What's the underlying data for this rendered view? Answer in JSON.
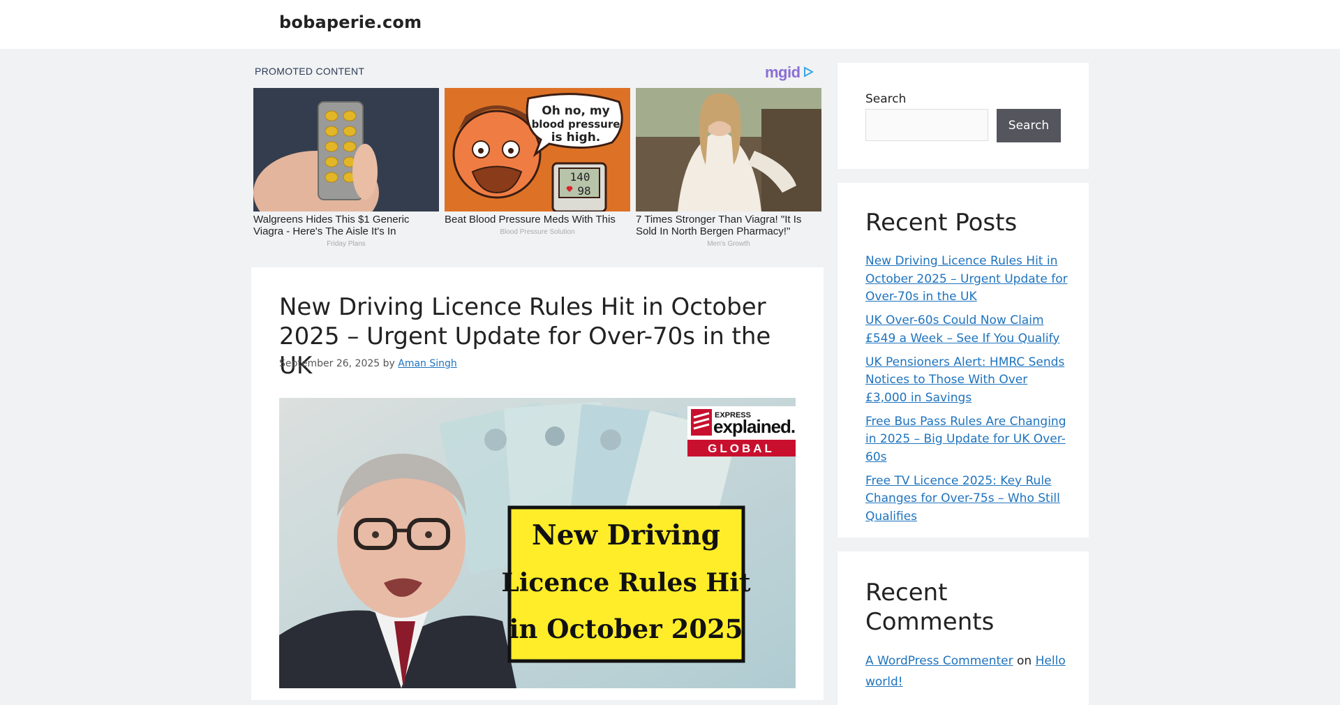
{
  "header": {
    "site_title": "bobaperie.com"
  },
  "promo": {
    "label": "PROMOTED CONTENT",
    "logo": "mgid",
    "cards": [
      {
        "title": "Walgreens Hides This $1 Generic Viagra - Here's The Aisle It's In",
        "source": "Friday Plans"
      },
      {
        "title": "Beat Blood Pressure Meds With This",
        "source": "Blood Pressure Solution",
        "bubble_line1": "Oh no, my",
        "bubble_line2": "blood pressure",
        "bubble_line3": "is high.",
        "monitor_top": "140",
        "monitor_bottom": "98"
      },
      {
        "title": "7 Times Stronger Than Viagra! \"It Is Sold In North Bergen Pharmacy!\"",
        "source": "Men's Growth"
      }
    ]
  },
  "article": {
    "title": "New Driving Licence Rules Hit in October 2025 – Urgent Update for Over-70s in the UK",
    "date": "September 26, 2025",
    "by": "by",
    "author": "Aman Singh",
    "image": {
      "badge_top": "EXPRESS",
      "badge_main": "explained.",
      "badge_sub": "GLOBAL",
      "headline_line1": "New Driving",
      "headline_line2": "Licence Rules Hit",
      "headline_line3": "in October 2025"
    }
  },
  "sidebar": {
    "search": {
      "label": "Search",
      "button": "Search",
      "placeholder": ""
    },
    "recent_posts": {
      "title": "Recent Posts",
      "items": [
        "New Driving Licence Rules Hit in October 2025 – Urgent Update for Over-70s in the UK",
        "UK Over-60s Could Now Claim £549 a Week – See If You Qualify",
        "UK Pensioners Alert: HMRC Sends Notices to Those With Over £3,000 in Savings",
        "Free Bus Pass Rules Are Changing in 2025 – Big Update for UK Over-60s",
        "Free TV Licence 2025: Key Rule Changes for Over-75s – Who Still Qualifies"
      ]
    },
    "recent_comments": {
      "title": "Recent Comments",
      "commenter": "A WordPress Commenter",
      "on": "on",
      "post": "Hello world!"
    }
  },
  "colors": {
    "link": "#1e73be",
    "search_button": "#55555e",
    "page_bg": "#f0f2f3",
    "badge_red": "#c8102e",
    "headline_yellow": "#ffed29"
  }
}
